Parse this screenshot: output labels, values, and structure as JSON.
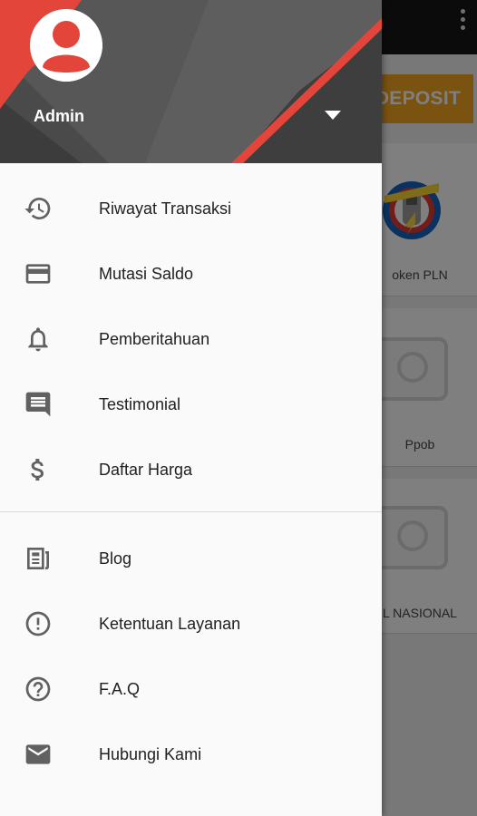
{
  "header": {
    "username": "Admin"
  },
  "menu_primary": [
    {
      "label": "Riwayat Transaksi",
      "icon": "history-icon"
    },
    {
      "label": "Mutasi Saldo",
      "icon": "credit-card-icon"
    },
    {
      "label": "Pemberitahuan",
      "icon": "bell-icon"
    },
    {
      "label": "Testimonial",
      "icon": "comment-icon"
    },
    {
      "label": "Daftar Harga",
      "icon": "dollar-icon"
    }
  ],
  "menu_secondary": [
    {
      "label": "Blog",
      "icon": "article-icon"
    },
    {
      "label": "Ketentuan Layanan",
      "icon": "alert-circle-icon"
    },
    {
      "label": "F.A.Q",
      "icon": "help-circle-icon"
    },
    {
      "label": "Hubungi Kami",
      "icon": "mail-icon"
    }
  ],
  "background_app": {
    "deposit_label": "DEPOSIT",
    "cards": [
      {
        "label": "oken PLN"
      },
      {
        "label": "Ppob"
      },
      {
        "label": "L NASIONAL"
      }
    ]
  },
  "colors": {
    "accent_red": "#e4453a",
    "header_dark": "#444444",
    "deposit_orange": "#f5a623"
  }
}
